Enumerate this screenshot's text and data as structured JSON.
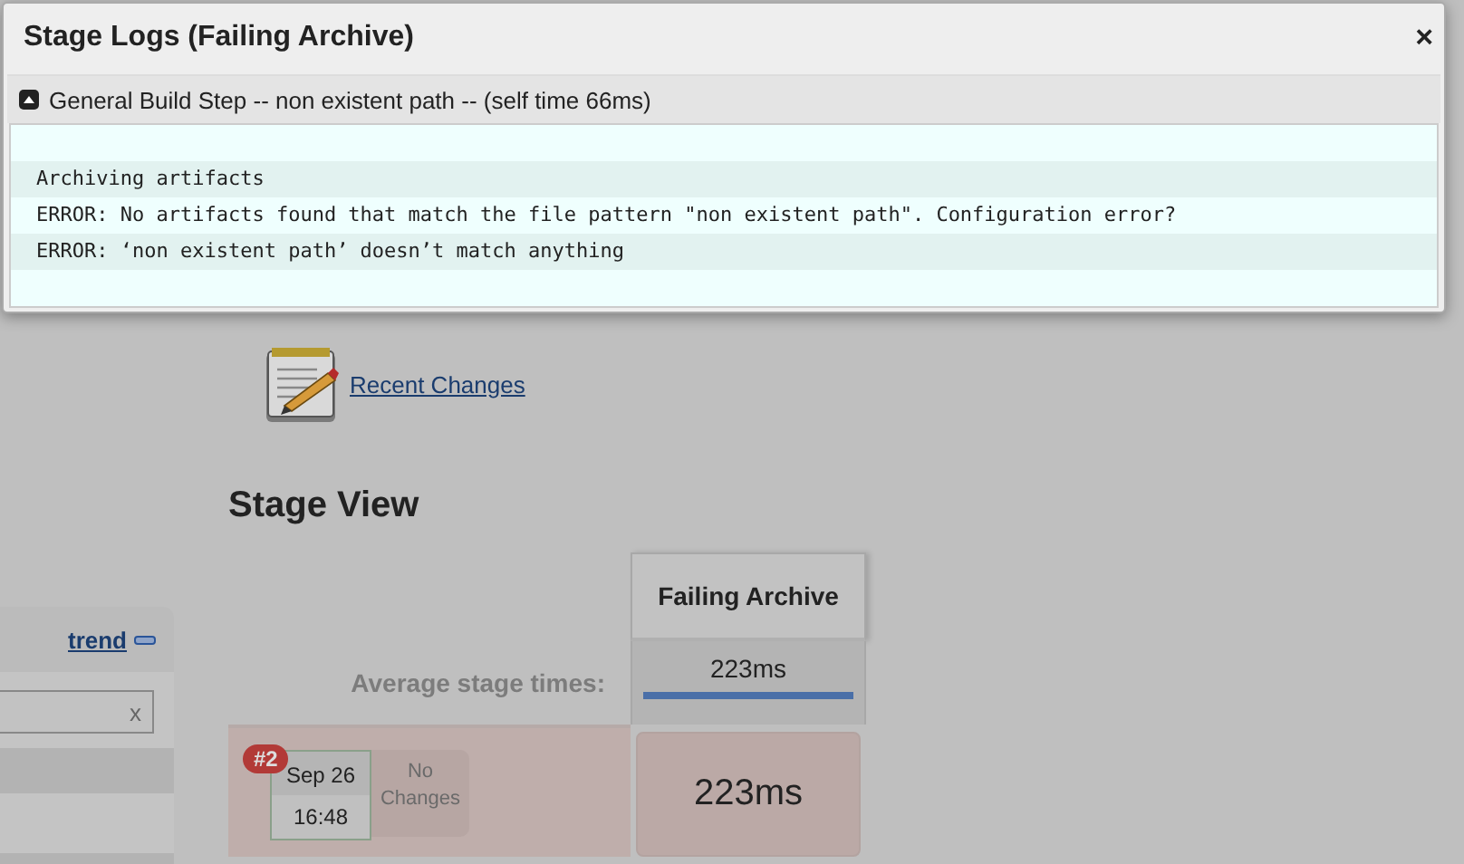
{
  "page": {
    "recent_changes": "Recent Changes",
    "heading": "Stage View",
    "sidebar": {
      "trend_link": "trend",
      "search_clear": "x"
    },
    "stage_view": {
      "average_label": "Average stage times:",
      "columns": [
        {
          "name": "Failing Archive",
          "average": "223ms",
          "level": 1
        }
      ],
      "builds": [
        {
          "number": "#2",
          "date": "Sep 26",
          "time": "16:48",
          "changes": "No Changes",
          "failed": true,
          "stages": [
            "223ms"
          ]
        }
      ]
    }
  },
  "modal": {
    "title": "Stage Logs (Failing Archive)",
    "close": "×",
    "step": {
      "expanded": true,
      "label": "General Build Step -- non existent path -- (self time 66ms)",
      "log_lines": [
        "Archiving artifacts",
        "ERROR: No artifacts found that match the file pattern \"non existent path\". Configuration error?",
        "ERROR: ‘non existent path’ doesn’t match anything"
      ]
    }
  }
}
